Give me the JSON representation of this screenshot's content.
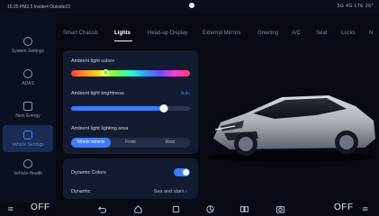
{
  "status": {
    "left_text": "15:25 PM2.5 Inside4 Outside23",
    "right_text": "5G 4G LTE 26°"
  },
  "sidebar": {
    "items": [
      {
        "label": "System Settings",
        "icon": "gear-icon"
      },
      {
        "label": "ADAS",
        "icon": "steering-icon"
      },
      {
        "label": "New Energy",
        "icon": "battery-icon"
      },
      {
        "label": "Vehicle Settings",
        "icon": "car-icon",
        "active": true
      },
      {
        "label": "Vehicle Health",
        "icon": "health-icon"
      }
    ]
  },
  "tabs": [
    {
      "label": "Smart Chassis"
    },
    {
      "label": "Lights",
      "active": true
    },
    {
      "label": "Head-up Display"
    },
    {
      "label": "External Mirrors"
    },
    {
      "label": "Greeting"
    },
    {
      "label": "A/C"
    },
    {
      "label": "Seat"
    },
    {
      "label": "Locks"
    },
    {
      "label": "N"
    }
  ],
  "ambient": {
    "colors_label": "Ambient light colors",
    "color_position": 0.29,
    "brightness_label": "Ambient light brightness",
    "brightness_auto": "Auto",
    "brightness_value": 0.78,
    "area_label": "Ambient light lighting area",
    "area_options": [
      "Whole vehicle",
      "Front",
      "Rear"
    ],
    "area_selected": 0
  },
  "dynamic": {
    "colors_label": "Dynamic Colors",
    "colors_on": true,
    "dynamic_label": "Dynamic",
    "dynamic_value": "Sea and stars"
  },
  "bottom": {
    "left_climate": "OFF",
    "right_climate": "OFF"
  },
  "colors": {
    "accent": "#3d7bff",
    "background": "#070a14",
    "panel": "#131b30"
  }
}
